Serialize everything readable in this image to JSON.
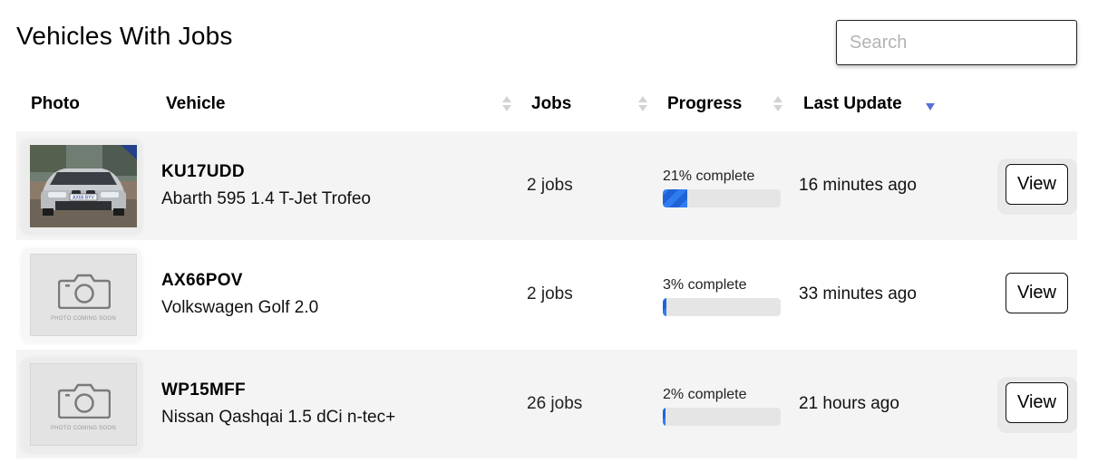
{
  "page": {
    "title": "Vehicles With Jobs"
  },
  "search": {
    "placeholder": "Search",
    "value": ""
  },
  "columns": {
    "photo": "Photo",
    "vehicle": "Vehicle",
    "jobs": "Jobs",
    "progress": "Progress",
    "last_update": "Last Update"
  },
  "sort": {
    "column": "Last Update",
    "direction": "descending"
  },
  "rows": [
    {
      "reg": "KU17UDD",
      "model": "Abarth 595 1.4 T-Jet Trofeo",
      "jobs": "2 jobs",
      "progress_label": "21% complete",
      "progress_percent": 21,
      "last_update": "16 minutes ago",
      "photo": "car-photo",
      "view_label": "View"
    },
    {
      "reg": "AX66POV",
      "model": "Volkswagen Golf 2.0",
      "jobs": "2 jobs",
      "progress_label": "3% complete",
      "progress_percent": 3,
      "last_update": "33 minutes ago",
      "photo": "photo-coming-soon",
      "view_label": "View"
    },
    {
      "reg": "WP15MFF",
      "model": "Nissan Qashqai 1.5 dCi n-tec+",
      "jobs": "26 jobs",
      "progress_label": "2% complete",
      "progress_percent": 2,
      "last_update": "21 hours ago",
      "photo": "photo-coming-soon",
      "view_label": "View"
    }
  ],
  "placeholder_photo_text": "PHOTO COMING SOON",
  "car_plate_text": "AX66 BYV",
  "colors": {
    "progress_fill": "#2f7cf0",
    "sort_active": "#5b6fd6",
    "row_alt": "#f4f4f4"
  }
}
